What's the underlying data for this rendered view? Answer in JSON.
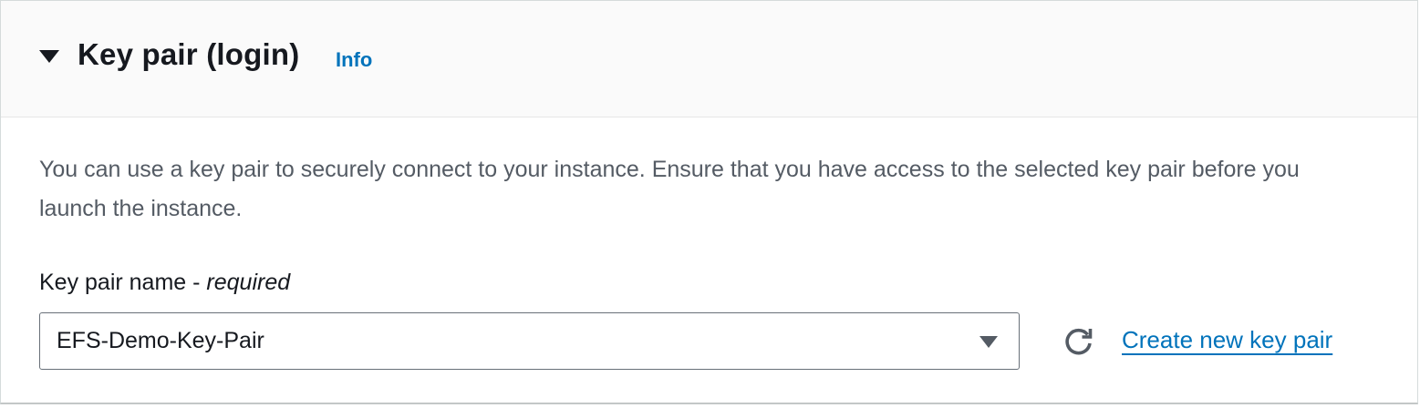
{
  "section": {
    "title": "Key pair (login)",
    "info_label": "Info",
    "expanded": true,
    "description": "You can use a key pair to securely connect to your instance. Ensure that you have access to the selected key pair before you launch the instance."
  },
  "key_pair_field": {
    "label": "Key pair name - ",
    "required_label": "required",
    "selected_value": "EFS-Demo-Key-Pair"
  },
  "actions": {
    "refresh_icon": "refresh-icon",
    "create_link_label": "Create new key pair"
  },
  "colors": {
    "link": "#0073bb",
    "text": "#16191f",
    "secondary_text": "#545b64",
    "header_background": "#fafafa"
  }
}
